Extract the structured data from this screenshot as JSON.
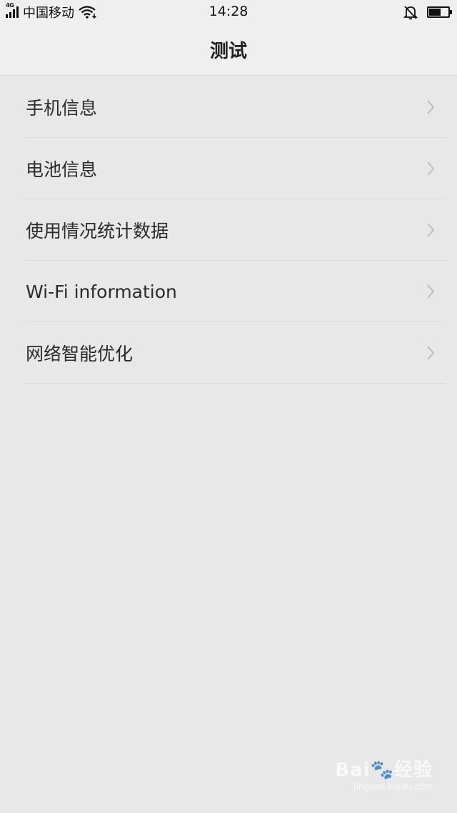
{
  "status": {
    "network_type": "4G",
    "carrier": "中国移动",
    "time": "14:28"
  },
  "header": {
    "title": "测试"
  },
  "menu": {
    "items": [
      {
        "label": "手机信息"
      },
      {
        "label": "电池信息"
      },
      {
        "label": "使用情况统计数据"
      },
      {
        "label": "Wi-Fi information"
      },
      {
        "label": "网络智能优化"
      }
    ]
  },
  "watermark": {
    "brand": "Bai🐾经验",
    "url": "jingyan.baidu.com"
  }
}
